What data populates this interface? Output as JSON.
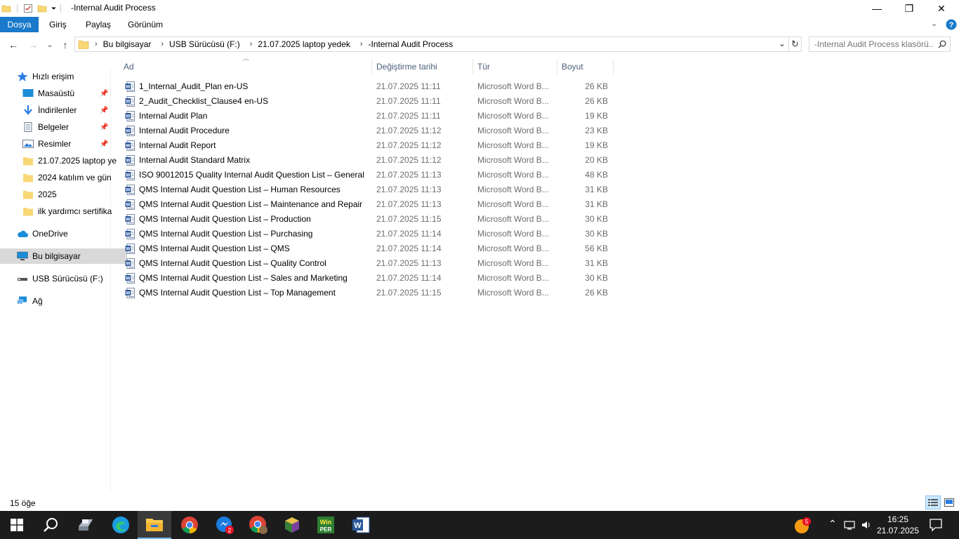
{
  "window": {
    "title": "-Internal Audit Process",
    "minimize": "—",
    "maximize": "❐",
    "close": "✕"
  },
  "ribbon": {
    "tabs": [
      "Dosya",
      "Giriş",
      "Paylaş",
      "Görünüm"
    ]
  },
  "address": {
    "crumbs": [
      "Bu bilgisayar",
      "USB Sürücüsü (F:)",
      "21.07.2025 laptop yedek",
      "-Internal Audit Process"
    ]
  },
  "search": {
    "placeholder": "-Internal Audit Process klasörü..."
  },
  "sidebar": {
    "items": [
      {
        "label": "Hızlı erişim"
      },
      {
        "label": "Masaüstü",
        "pinned": true
      },
      {
        "label": "İndirilenler",
        "pinned": true
      },
      {
        "label": "Belgeler",
        "pinned": true
      },
      {
        "label": "Resimler",
        "pinned": true
      },
      {
        "label": "21.07.2025 laptop ye"
      },
      {
        "label": "2024 katılım ve gün"
      },
      {
        "label": "2025"
      },
      {
        "label": "ilk yardımcı sertifika"
      },
      {
        "label": "OneDrive"
      },
      {
        "label": "Bu bilgisayar"
      },
      {
        "label": "USB Sürücüsü (F:)"
      },
      {
        "label": "Ağ"
      }
    ]
  },
  "columns": {
    "name": "Ad",
    "date": "Değiştirme tarihi",
    "type": "Tür",
    "size": "Boyut"
  },
  "files": [
    {
      "name": "1_Internal_Audit_Plan en-US",
      "date": "21.07.2025 11:11",
      "type": "Microsoft Word B...",
      "size": "26 KB"
    },
    {
      "name": "2_Audit_Checklist_Clause4 en-US",
      "date": "21.07.2025 11:11",
      "type": "Microsoft Word B...",
      "size": "26 KB"
    },
    {
      "name": "Internal Audit Plan",
      "date": "21.07.2025 11:11",
      "type": "Microsoft Word B...",
      "size": "19 KB"
    },
    {
      "name": "Internal Audit Procedure",
      "date": "21.07.2025 11:12",
      "type": "Microsoft Word B...",
      "size": "23 KB"
    },
    {
      "name": "Internal Audit Report",
      "date": "21.07.2025 11:12",
      "type": "Microsoft Word B...",
      "size": "19 KB"
    },
    {
      "name": "Internal Audit Standard Matrix",
      "date": "21.07.2025 11:12",
      "type": "Microsoft Word B...",
      "size": "20 KB"
    },
    {
      "name": "ISO 90012015 Quality Internal Audit Question List – General",
      "date": "21.07.2025 11:13",
      "type": "Microsoft Word B...",
      "size": "48 KB"
    },
    {
      "name": "QMS Internal Audit Question List – Human Resources",
      "date": "21.07.2025 11:13",
      "type": "Microsoft Word B...",
      "size": "31 KB"
    },
    {
      "name": "QMS Internal Audit Question List – Maintenance and Repair",
      "date": "21.07.2025 11:13",
      "type": "Microsoft Word B...",
      "size": "31 KB"
    },
    {
      "name": "QMS Internal Audit Question List – Production",
      "date": "21.07.2025 11:15",
      "type": "Microsoft Word B...",
      "size": "30 KB"
    },
    {
      "name": "QMS Internal Audit Question List – Purchasing",
      "date": "21.07.2025 11:14",
      "type": "Microsoft Word B...",
      "size": "30 KB"
    },
    {
      "name": "QMS Internal Audit Question List – QMS",
      "date": "21.07.2025 11:14",
      "type": "Microsoft Word B...",
      "size": "56 KB"
    },
    {
      "name": "QMS Internal Audit Question List – Quality Control",
      "date": "21.07.2025 11:13",
      "type": "Microsoft Word B...",
      "size": "31 KB"
    },
    {
      "name": "QMS Internal Audit Question List – Sales and Marketing",
      "date": "21.07.2025 11:14",
      "type": "Microsoft Word B...",
      "size": "30 KB"
    },
    {
      "name": "QMS Internal Audit Question List – Top Management",
      "date": "21.07.2025 11:15",
      "type": "Microsoft Word B...",
      "size": "26 KB"
    }
  ],
  "status": {
    "count": "15 öğe"
  },
  "taskbar": {
    "apps": [
      "start-icon",
      "search-icon",
      "printer-app-icon",
      "edge-icon",
      "file-explorer-icon",
      "chrome-icon",
      "messenger-app-icon",
      "chrome-profile-icon",
      "winrar-icon",
      "winper-icon",
      "word-icon"
    ],
    "notification_badge": "5",
    "app_badge": "2",
    "time": "16:25",
    "date": "21.07.2025"
  }
}
